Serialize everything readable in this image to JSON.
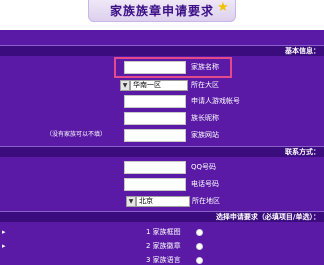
{
  "banner": {
    "title": "家族族章申请要求",
    "ghost_left": "",
    "ghost_right": "",
    "star_icon": "star-icon",
    "star_color": "#f2c200"
  },
  "sections": {
    "basic": "基本信息：",
    "contact": "联系方式：",
    "requirements": "选择申请要求（必填项目/单选）："
  },
  "basic": {
    "family_name_label": "家族名称",
    "family_name_value": "",
    "region_label": "所在大区",
    "region_value": "华南一区",
    "applicant_id_label": "申请人游戏帐号",
    "applicant_id_value": "",
    "chief_label": "族长昵称",
    "chief_value": "",
    "website_label": "家族网站",
    "website_value": "",
    "website_note": "（没有家族可以不填）"
  },
  "contact": {
    "qq_label": "QQ号码",
    "qq_value": "",
    "phone_label": "电话号码",
    "phone_value": "",
    "area_label": "所在地区",
    "area_value": "北京"
  },
  "requirements": {
    "options": [
      "1  家族框图",
      "2  家族徽章",
      "3  家族语言"
    ]
  },
  "colors": {
    "background": "#5a1aa6",
    "section_bar": "#3b0c7d",
    "highlight": "#e24a8a"
  }
}
